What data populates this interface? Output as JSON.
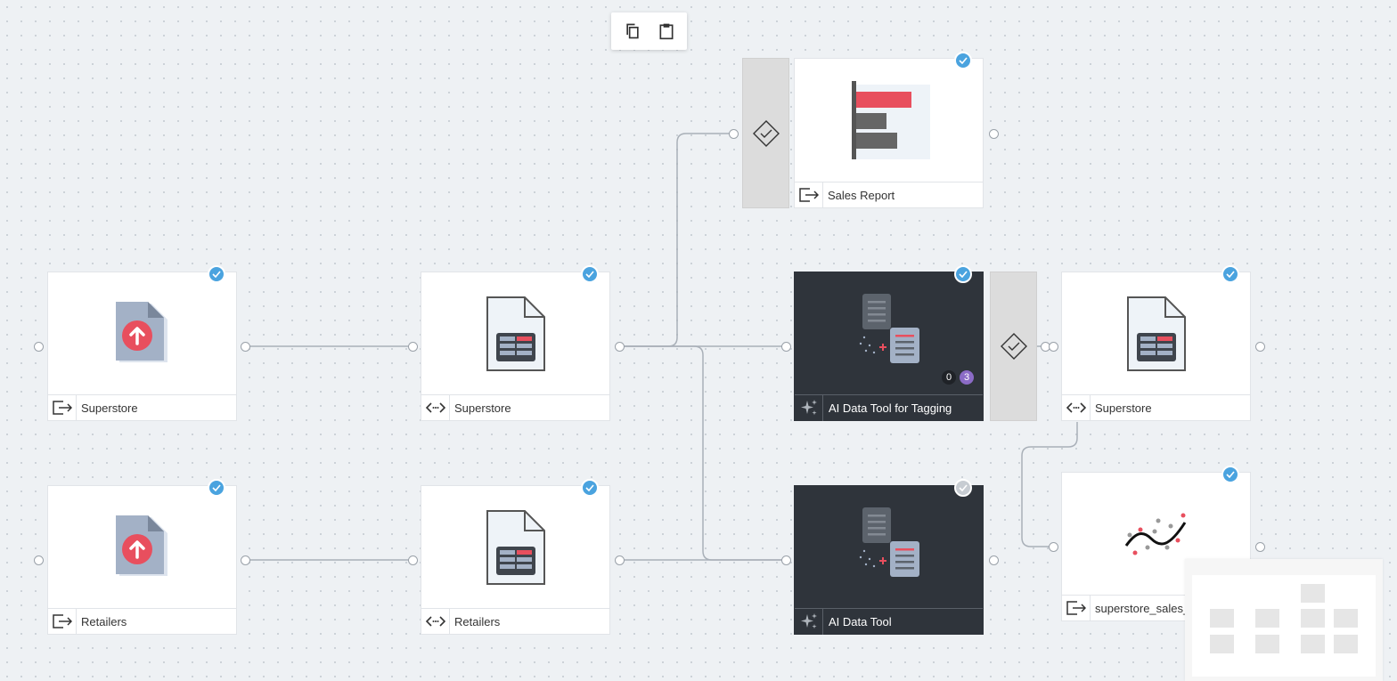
{
  "toolbar": {
    "copy_icon": "copy-icon",
    "paste_icon": "clipboard-icon"
  },
  "nodes": {
    "upload_superstore": {
      "label": "Superstore",
      "icon": "file-upload-icon",
      "footer_icon": "output-icon"
    },
    "upload_retailers": {
      "label": "Retailers",
      "icon": "file-upload-icon",
      "footer_icon": "output-icon"
    },
    "dataset_superstore": {
      "label": "Superstore",
      "icon": "spreadsheet-file-icon",
      "footer_icon": "code-icon"
    },
    "dataset_retailers": {
      "label": "Retailers",
      "icon": "spreadsheet-file-icon",
      "footer_icon": "code-icon"
    },
    "sales_report": {
      "label": "Sales Report",
      "icon": "bar-chart-icon",
      "footer_icon": "output-icon"
    },
    "ai_tagging": {
      "label": "AI Data Tool for Tagging",
      "icon": "ai-document-icon",
      "footer_icon": "sparkle-icon",
      "badge_zero": "0",
      "badge_three": "3"
    },
    "ai_tool": {
      "label": "AI Data Tool",
      "icon": "ai-document-icon",
      "footer_icon": "sparkle-icon"
    },
    "result_superstore": {
      "label": "Superstore",
      "icon": "spreadsheet-file-icon",
      "footer_icon": "code-icon"
    },
    "superstore_sales": {
      "label": "superstore_sales_x",
      "icon": "trend-line-icon",
      "footer_icon": "output-icon"
    }
  },
  "colors": {
    "accent": "#4aa3df",
    "red": "#e84f5e",
    "dark": "#2f343b",
    "purple": "#8b6bc6"
  }
}
